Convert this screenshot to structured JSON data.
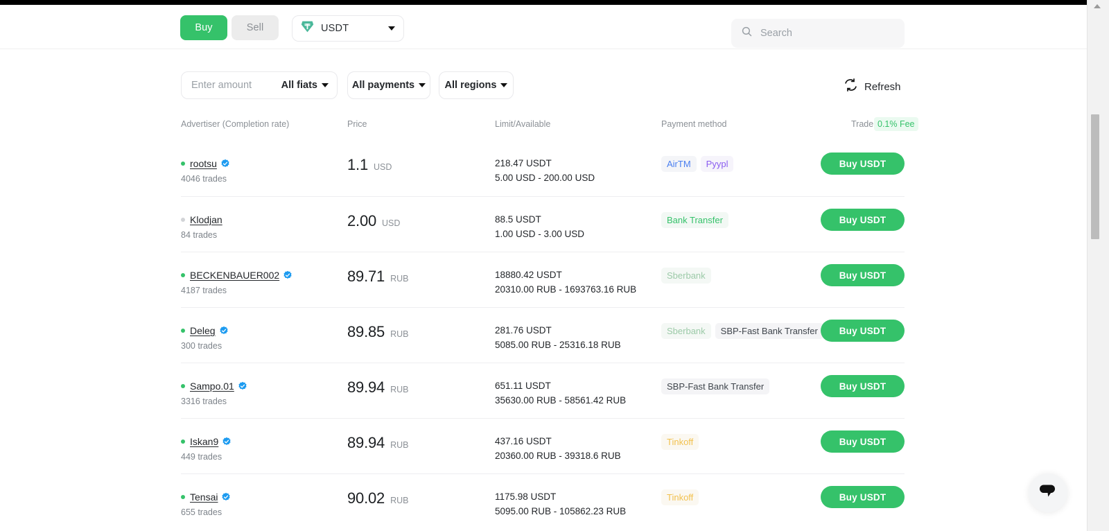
{
  "header": {
    "buy_label": "Buy",
    "sell_label": "Sell",
    "coin": "USDT",
    "coin_icon": "tether-icon",
    "search_placeholder": "Search",
    "search_value": ""
  },
  "filters": {
    "amount_placeholder": "Enter amount",
    "amount_value": "",
    "fiat_label": "All fiats",
    "payments_label": "All payments",
    "regions_label": "All regions",
    "refresh_label": "Refresh"
  },
  "table": {
    "columns": {
      "advertiser": "Advertiser (Completion rate)",
      "price": "Price",
      "limit": "Limit/Available",
      "payment": "Payment method",
      "trade": "Trade",
      "fee_badge": "0.1% Fee"
    },
    "rows": [
      {
        "name": "rootsu",
        "status": "online",
        "verified": true,
        "trades": "4046 trades",
        "price": "1.1",
        "currency": "USD",
        "available": "218.47 USDT",
        "limit": "5.00 USD - 200.00 USD",
        "payments": [
          {
            "label": "AirTM",
            "style": "blue"
          },
          {
            "label": "Pyypl",
            "style": "purple"
          }
        ],
        "action": "Buy USDT"
      },
      {
        "name": "Klodjan",
        "status": "offline",
        "verified": false,
        "trades": "84 trades",
        "price": "2.00",
        "currency": "USD",
        "available": "88.5 USDT",
        "limit": "1.00 USD - 3.00 USD",
        "payments": [
          {
            "label": "Bank Transfer",
            "style": "green"
          }
        ],
        "action": "Buy USDT"
      },
      {
        "name": "BECKENBAUER002",
        "status": "online",
        "verified": true,
        "trades": "4187 trades",
        "price": "89.71",
        "currency": "RUB",
        "available": "18880.42 USDT",
        "limit": "20310.00 RUB - 1693763.16 RUB",
        "payments": [
          {
            "label": "Sberbank",
            "style": "sber"
          }
        ],
        "action": "Buy USDT"
      },
      {
        "name": "Deleg",
        "status": "online",
        "verified": true,
        "trades": "300 trades",
        "price": "89.85",
        "currency": "RUB",
        "available": "281.76 USDT",
        "limit": "5085.00 RUB - 25316.18 RUB",
        "payments": [
          {
            "label": "Sberbank",
            "style": "sber"
          },
          {
            "label": "SBP-Fast Bank Transfer",
            "style": "gray"
          }
        ],
        "action": "Buy USDT"
      },
      {
        "name": "Sampo.01",
        "status": "online",
        "verified": true,
        "trades": "3316 trades",
        "price": "89.94",
        "currency": "RUB",
        "available": "651.11 USDT",
        "limit": "35630.00 RUB - 58561.42 RUB",
        "payments": [
          {
            "label": "SBP-Fast Bank Transfer",
            "style": "gray"
          }
        ],
        "action": "Buy USDT"
      },
      {
        "name": "Iskan9",
        "status": "online",
        "verified": true,
        "trades": "449 trades",
        "price": "89.94",
        "currency": "RUB",
        "available": "437.16 USDT",
        "limit": "20360.00 RUB - 39318.6 RUB",
        "payments": [
          {
            "label": "Tinkoff",
            "style": "amber"
          }
        ],
        "action": "Buy USDT"
      },
      {
        "name": "Tensai",
        "status": "online",
        "verified": true,
        "trades": "655 trades",
        "price": "90.02",
        "currency": "RUB",
        "available": "1175.98 USDT",
        "limit": "5095.00 RUB - 105862.23 RUB",
        "payments": [
          {
            "label": "Tinkoff",
            "style": "amber"
          }
        ],
        "action": "Buy USDT"
      }
    ]
  },
  "chat": {
    "icon": "chat-bubble-icon"
  },
  "colors": {
    "accent_green": "#35c26a",
    "fee_badge_bg": "#eafaf0",
    "verified_blue": "#1d9bf0"
  }
}
